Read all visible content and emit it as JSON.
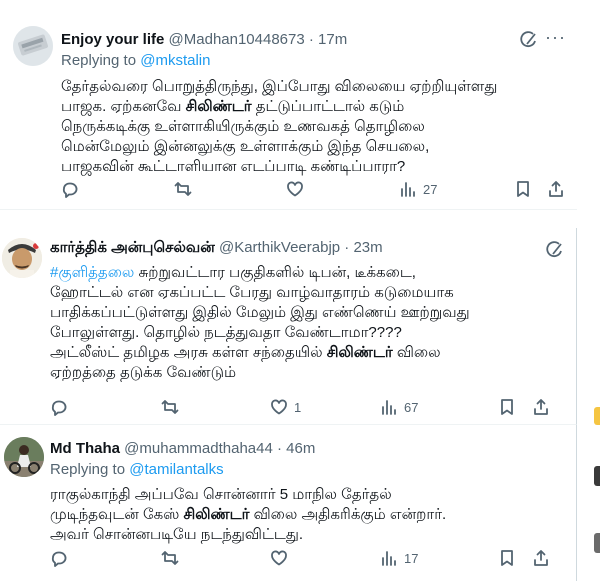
{
  "tweets": [
    {
      "name": "Enjoy your life",
      "handle": "@Madhan10448673",
      "time": "· 17m",
      "replying_label": "Replying to ",
      "replying_handle": "@mkstalin",
      "lines": [
        "தேர்தல்வரை பொறுத்திருந்து, இப்போது விலையை ஏற்றியுள்ளது",
        "பாஜக. ஏற்கனவே ",
        "சிலிண்டர்",
        " தட்டுப்பாட்டால் கடும்",
        "நெருக்கடிக்கு உள்ளாகியிருக்கும் உணவகத் தொழிலை",
        "மென்மேலும் இன்னலுக்கு உள்ளாக்கும் இந்த செயலை,",
        "பாஜகவின் கூட்டாளியான எடப்பாடி கண்டிப்பாரா?"
      ],
      "stats": {
        "replies": "",
        "retweets": "",
        "likes": "",
        "views": "27"
      }
    },
    {
      "name": "கார்த்திக் அன்புசெல்வன்",
      "handle": "@KarthikVeerabjp",
      "time": "· 23m",
      "hashtag": "#குளித்தலை",
      "lines": [
        " சுற்றுவட்டார பகுதிகளில் டிபன், டீக்கடை,",
        "ஹோட்டல் என ஏகப்பட்ட பேரது வாழ்வாதாரம் கடுமையாக",
        "பாதிக்கப்பட்டுள்ளது இதில் மேலும் இது எண்ணெய் ஊற்றுவது",
        "போலுள்ளது. தொழில் நடத்துவதா வேண்டாமா????",
        "அட்லீஸ்ட் தமிழக அரசு கள்ள சந்தையில் ",
        "சிலிண்டர்",
        " விலை",
        "ஏற்றத்தை தடுக்க வேண்டும்"
      ],
      "stats": {
        "replies": "",
        "retweets": "",
        "likes": "1",
        "views": "67"
      }
    },
    {
      "name": "Md Thaha",
      "handle": "@muhammadthaha44",
      "time": "· 46m",
      "replying_label": "Replying to ",
      "replying_handle": "@tamilantalks",
      "lines": [
        "ராகுல்காந்தி அப்பவே சொன்னார் 5 மாநில தேர்தல்",
        "முடிந்தவுடன் கேஸ் ",
        "சிலிண்டர்",
        " விலை அதிகரிக்கும் என்றார்.",
        "அவர் சொன்னபடியே நடந்துவிட்டது."
      ],
      "stats": {
        "replies": "",
        "retweets": "",
        "likes": "",
        "views": "17"
      }
    }
  ],
  "icons": {
    "reply": "reply-icon",
    "retweet": "retweet-icon",
    "like": "like-icon",
    "views": "views-icon",
    "bookmark": "bookmark-icon",
    "share": "share-icon",
    "grok": "grok-icon",
    "more": "more-icon"
  },
  "colors": {
    "link": "#1d9bf0",
    "muted": "#536471",
    "text": "#0f1419"
  }
}
